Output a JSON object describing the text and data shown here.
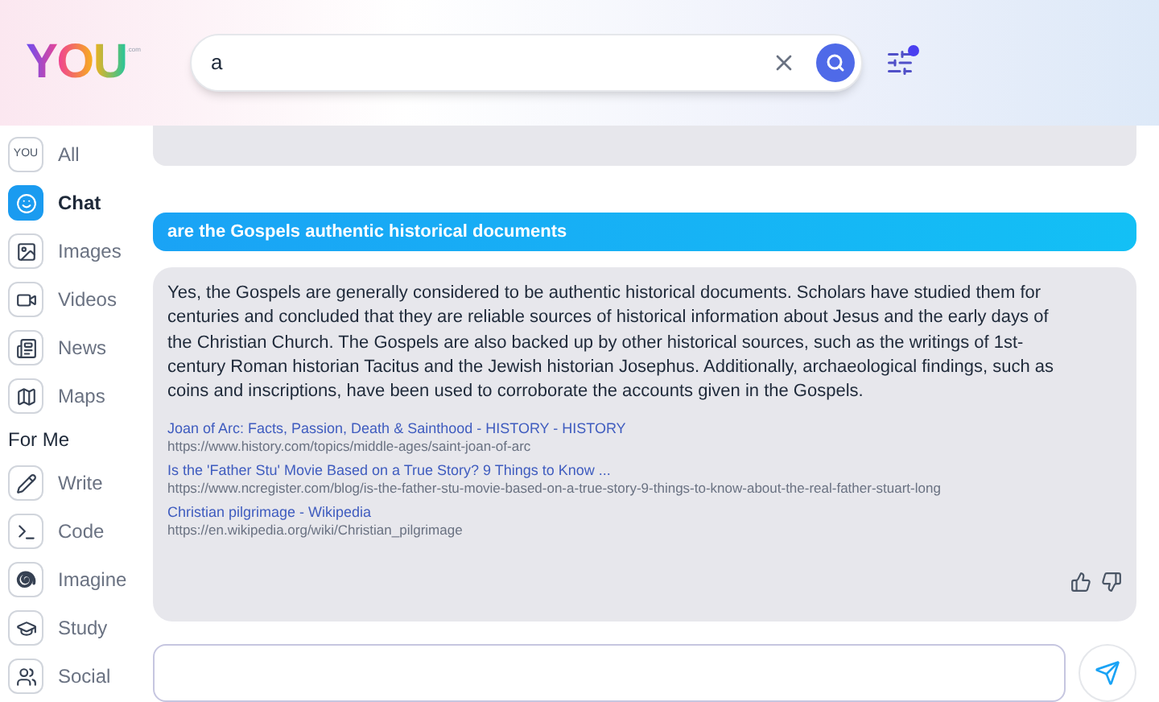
{
  "logo": {
    "text": "YOU",
    "suffix": ".com"
  },
  "search": {
    "value": "a"
  },
  "sidebar": {
    "items": [
      {
        "kind": "all",
        "badge": "YOU",
        "label": "All",
        "selected": false
      },
      {
        "kind": "chat",
        "label": "Chat",
        "selected": true
      },
      {
        "kind": "images",
        "label": "Images",
        "selected": false
      },
      {
        "kind": "videos",
        "label": "Videos",
        "selected": false
      },
      {
        "kind": "news",
        "label": "News",
        "selected": false
      },
      {
        "kind": "maps",
        "label": "Maps",
        "selected": false
      }
    ],
    "section_title": "For Me",
    "section_items": [
      {
        "kind": "write",
        "label": "Write",
        "selected": false
      },
      {
        "kind": "code",
        "label": "Code",
        "selected": false
      },
      {
        "kind": "imagine",
        "label": "Imagine",
        "selected": false
      },
      {
        "kind": "study",
        "label": "Study",
        "selected": false
      },
      {
        "kind": "social",
        "label": "Social",
        "selected": false
      }
    ]
  },
  "chat": {
    "question": "are the Gospels authentic historical documents",
    "answer": "Yes, the Gospels are generally considered to be authentic historical documents. Scholars have studied them for centuries and concluded that they are reliable sources of historical information about Jesus and the early days of the Christian Church. The Gospels are also backed up by other historical sources, such as the writings of 1st-century Roman historian Tacitus and the Jewish historian Josephus. Additionally, archaeological findings, such as coins and inscriptions, have been used to corroborate the accounts given in the Gospels.",
    "sources": [
      {
        "title": "Joan of Arc: Facts, Passion, Death & Sainthood - HISTORY - HISTORY",
        "url": "https://www.history.com/topics/middle-ages/saint-joan-of-arc"
      },
      {
        "title": "Is the 'Father Stu' Movie Based on a True Story? 9 Things to Know ...",
        "url": "https://www.ncregister.com/blog/is-the-father-stu-movie-based-on-a-true-story-9-things-to-know-about-the-real-father-stuart-long"
      },
      {
        "title": "Christian pilgrimage - Wikipedia",
        "url": "https://en.wikipedia.org/wiki/Christian_pilgrimage"
      }
    ]
  }
}
